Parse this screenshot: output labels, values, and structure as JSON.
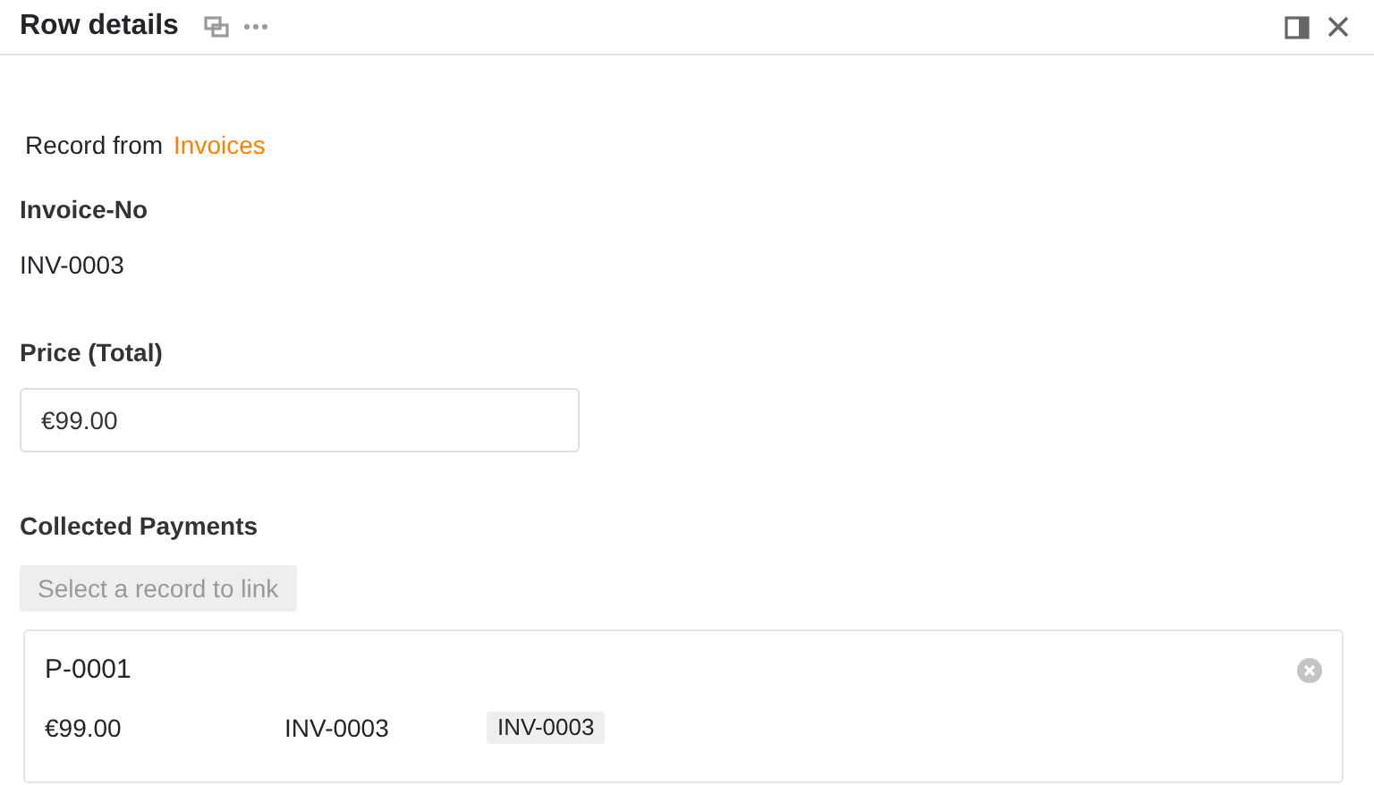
{
  "panel": {
    "title": "Row details"
  },
  "source": {
    "prefix": "Record from",
    "table": "Invoices"
  },
  "fields": [
    {
      "kind": "text",
      "label": "Invoice-No",
      "value": "INV-0003"
    },
    {
      "kind": "input",
      "label": "Price (Total)",
      "value": "€99.00"
    },
    {
      "kind": "links",
      "label": "Collected Payments",
      "button": "Select a record to link",
      "records": [
        {
          "title": "P-0001",
          "cells": [
            {
              "kind": "plain",
              "text": "€99.00"
            },
            {
              "kind": "plain",
              "text": "INV-0003"
            },
            {
              "kind": "tag",
              "text": "INV-0003"
            }
          ]
        }
      ]
    }
  ]
}
